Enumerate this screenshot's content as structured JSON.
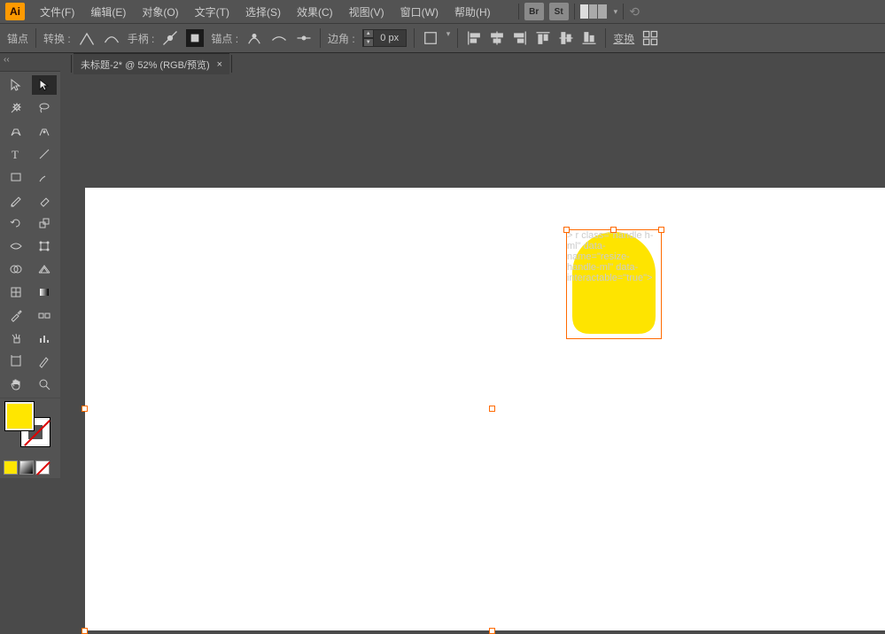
{
  "app": {
    "logo": "Ai"
  },
  "menu": {
    "items": [
      "文件(F)",
      "编辑(E)",
      "对象(O)",
      "文字(T)",
      "选择(S)",
      "效果(C)",
      "视图(V)",
      "窗口(W)",
      "帮助(H)"
    ],
    "br": "Br",
    "st": "St"
  },
  "options": {
    "anchor_label": "锚点",
    "convert_label": "转换 :",
    "handle_label": "手柄 :",
    "anchor2_label": "锚点 :",
    "corner_label": "边角 :",
    "corner_value": "0 px",
    "transform_label": "变换"
  },
  "tab": {
    "title": "未标题-2* @ 52% (RGB/预览)"
  },
  "colors": {
    "fill": "#ffe600",
    "shape_fill": "#fee400",
    "selection": "#ff6a00"
  },
  "tools": {
    "list": [
      "selection-tool",
      "direct-selection-tool",
      "magic-wand-tool",
      "lasso-tool",
      "pen-tool",
      "curvature-tool",
      "type-tool",
      "line-segment-tool",
      "rectangle-tool",
      "paintbrush-tool",
      "pencil-tool",
      "eraser-tool",
      "rotate-tool",
      "scale-tool",
      "width-tool",
      "free-transform-tool",
      "shape-builder-tool",
      "perspective-grid-tool",
      "mesh-tool",
      "gradient-tool",
      "eyedropper-tool",
      "blend-tool",
      "symbol-sprayer-tool",
      "column-graph-tool",
      "artboard-tool",
      "slice-tool",
      "hand-tool",
      "zoom-tool"
    ]
  }
}
